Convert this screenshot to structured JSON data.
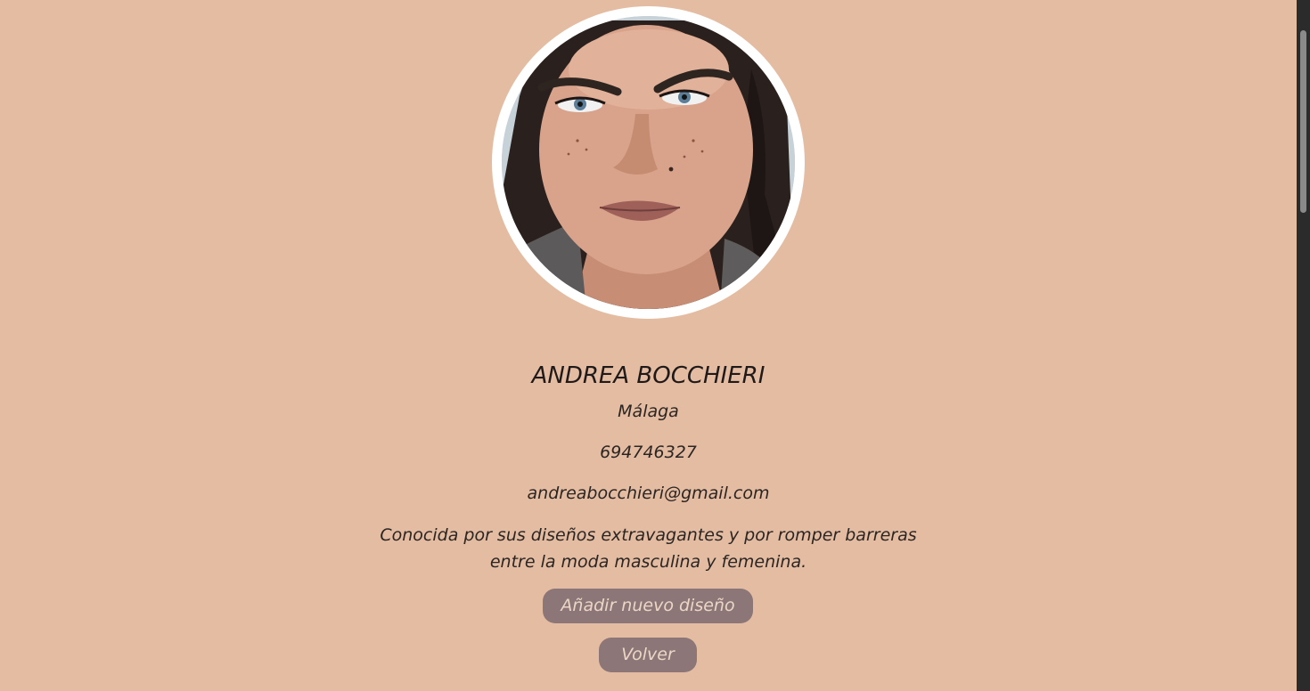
{
  "profile": {
    "name": "ANDREA BOCCHIERI",
    "city": "Málaga",
    "phone": "694746327",
    "email": "andreabocchieri@gmail.com",
    "bio": "Conocida por sus diseños extravagantes y por romper barreras entre la moda masculina y femenina."
  },
  "actions": {
    "add_design_label": "Añadir nuevo diseño",
    "back_label": "Volver"
  },
  "colors": {
    "background": "#e4bca2",
    "button": "#8c7677",
    "button_text": "#ecd6c6"
  }
}
